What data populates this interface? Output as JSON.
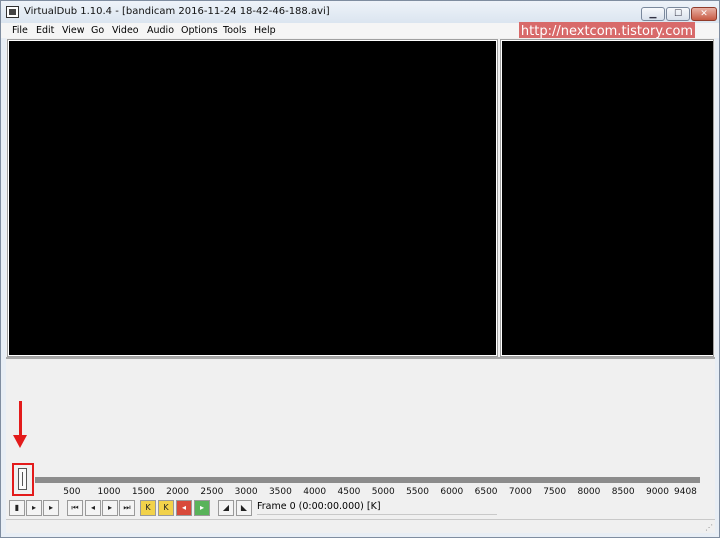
{
  "window": {
    "title": "VirtualDub 1.10.4 - [bandicam 2016-11-24 18-42-46-188.avi]",
    "minimize_glyph": "▁",
    "maximize_glyph": "☐",
    "close_glyph": "✕"
  },
  "menu": [
    "File",
    "Edit",
    "View",
    "Go",
    "Video",
    "Audio",
    "Options",
    "Tools",
    "Help"
  ],
  "watermark": "http://nextcom.tistory.com",
  "timeline": {
    "ticks": [
      "500",
      "1000",
      "1500",
      "2000",
      "2500",
      "3000",
      "3500",
      "4000",
      "4500",
      "5000",
      "5500",
      "6000",
      "6500",
      "7000",
      "7500",
      "8000",
      "8500",
      "9000",
      "9408"
    ],
    "total_frames": 9408,
    "current_frame": 0
  },
  "toolbar": {
    "buttons": [
      {
        "name": "stop",
        "glyph": "▮",
        "style": ""
      },
      {
        "name": "play-input",
        "glyph": "▸",
        "style": ""
      },
      {
        "name": "play-output",
        "glyph": "▸",
        "style": ""
      },
      {
        "name": "start",
        "glyph": "⏮",
        "style": ""
      },
      {
        "name": "prev-frame",
        "glyph": "◂",
        "style": ""
      },
      {
        "name": "next-frame",
        "glyph": "▸",
        "style": ""
      },
      {
        "name": "end",
        "glyph": "⏭",
        "style": ""
      },
      {
        "name": "prev-key",
        "glyph": "K",
        "style": "yellow"
      },
      {
        "name": "next-key",
        "glyph": "K",
        "style": "yellow"
      },
      {
        "name": "scene-back",
        "glyph": "◂",
        "style": "red"
      },
      {
        "name": "scene-fwd",
        "glyph": "▸",
        "style": "green"
      },
      {
        "name": "mark-in",
        "glyph": "◢",
        "style": ""
      },
      {
        "name": "mark-out",
        "glyph": "◣",
        "style": ""
      }
    ],
    "frame_text": "Frame 0 (0:00:00.000) [K]"
  },
  "colors": {
    "annotation": "#e31b1b",
    "watermark_bg": "#d86a6a",
    "pane_bg": "#000000"
  }
}
